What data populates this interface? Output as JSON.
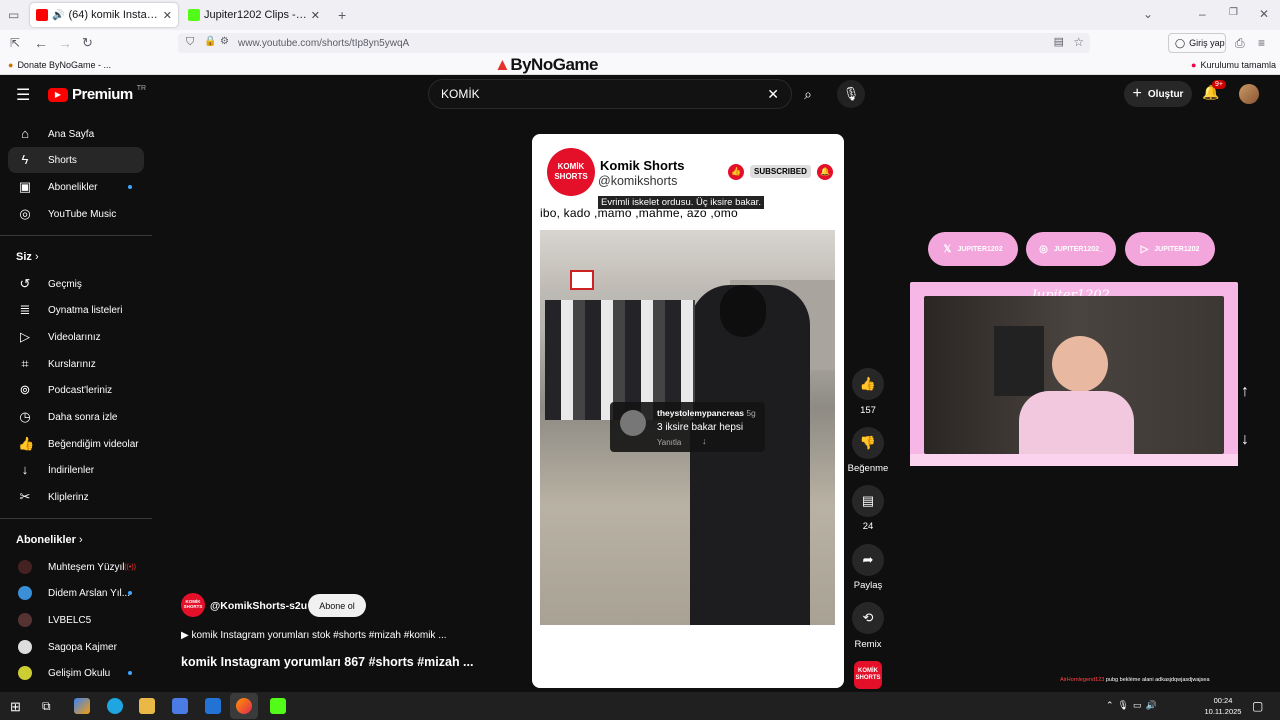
{
  "browser": {
    "tabs": [
      {
        "title": "(64) komik Instagram yorum",
        "active": true
      },
      {
        "title": "Jupiter1202 Clips - Watch Live c",
        "active": false
      }
    ],
    "url": "www.youtube.com/shorts/tIp8yn5ywqA",
    "signin_label": "Giriş yap",
    "bookmark": "Donate ByNoGame - ...",
    "bookmark_right": "Kurulumu tamamla",
    "brand_overlay": "ByNoGame"
  },
  "youtube": {
    "logo_text": "Premium",
    "logo_sup": "TR",
    "search_value": "KOMİK",
    "create_label": "Oluştur",
    "notif_count": "9+"
  },
  "sidebar": {
    "items": [
      {
        "label": "Ana Sayfa",
        "icon": "home-icon"
      },
      {
        "label": "Shorts",
        "icon": "shorts-icon"
      },
      {
        "label": "Abonelikler",
        "icon": "subscriptions-icon"
      },
      {
        "label": "YouTube Music",
        "icon": "music-icon"
      }
    ],
    "you_header": "Siz",
    "you_items": [
      {
        "label": "Geçmiş",
        "icon": "history-icon"
      },
      {
        "label": "Oynatma listeleri",
        "icon": "playlist-icon"
      },
      {
        "label": "Videolarınız",
        "icon": "video-icon"
      },
      {
        "label": "Kurslarınız",
        "icon": "courses-icon"
      },
      {
        "label": "Podcast'leriniz",
        "icon": "podcast-icon"
      },
      {
        "label": "Daha sonra izle",
        "icon": "watch-later-icon"
      },
      {
        "label": "Beğendiğim videolar",
        "icon": "like-icon"
      },
      {
        "label": "İndirilenler",
        "icon": "download-icon"
      },
      {
        "label": "Kliplerinz",
        "icon": "clip-icon"
      }
    ],
    "subs_header": "Abonelikler",
    "subs": [
      {
        "label": "Muhteşem Yüzyıl",
        "badge": "((•))"
      },
      {
        "label": "Didem Arslan Yıl..."
      },
      {
        "label": "LVBELC5"
      },
      {
        "label": "Sagopa Kajmer"
      },
      {
        "label": "Gelişim Okulu"
      }
    ]
  },
  "short": {
    "channel_name": "Komik Shorts",
    "channel_handle": "@komikshorts",
    "channel_logo": "KOMİK SHORTS",
    "subscribed_label": "SUBSCRIBED",
    "caption_overlay": "Evrimli iskelet ordusu. Üç iksire bakar.",
    "caption_line": "ibo, kado ,mamo ,mahme, azo ,omo",
    "comment_user": "theystolemypancreas",
    "comment_age": "5g",
    "comment_text": "3 iksire bakar hepsi",
    "comment_reply": "Yanıtla",
    "uploader": "@KomikShorts-s2u",
    "subscribe_label": "Abone ol",
    "description": "▶ komik Instagram yorumları stok #shorts #mizah #komik ...",
    "title": "komik Instagram yorumları 867 #shorts #mizah ..."
  },
  "actions": {
    "likes": "157",
    "dislike_label": "Beğenme",
    "comments": "24",
    "share_label": "Paylaş",
    "remix_label": "Remix"
  },
  "stream": {
    "name": "Jupiter1202_",
    "socials": [
      "JUPITER1202",
      "JUPITER1202_",
      "JUPITER1202"
    ],
    "ticker": "pubg beklème alani adkasjdqwjasdjwajsea",
    "ticker_name": "AirHornlegend123"
  },
  "taskbar": {
    "time": "00:24",
    "date": "10.11.2025"
  }
}
